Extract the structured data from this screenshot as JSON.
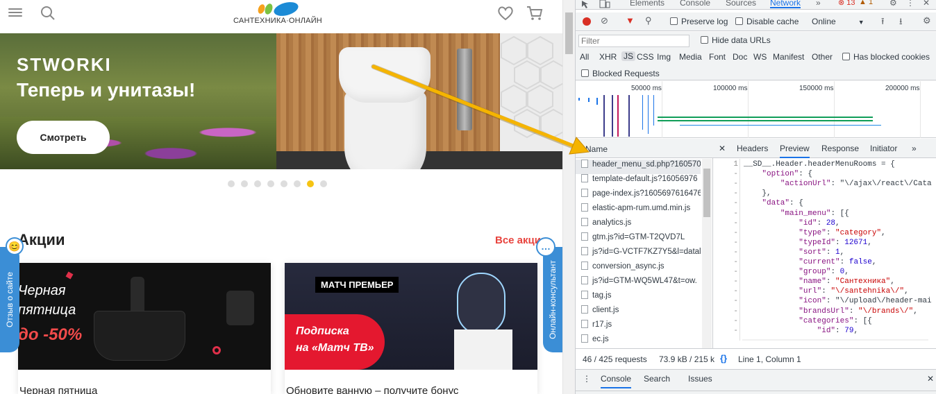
{
  "site": {
    "logo_text": "САНТЕХНИКА·ОНЛАЙН",
    "hero": {
      "brand": "STWORKI",
      "headline": "Теперь и унитазы!",
      "button": "Смотреть",
      "active_slide": 7,
      "slide_count": 8
    },
    "promotions": {
      "title": "Акции",
      "all_link": "Все акции",
      "cards": [
        {
          "caption_l1": "Черная",
          "caption_l2": "пятница",
          "discount": "до -50%",
          "title": "Черная пятница"
        },
        {
          "logo": "МАТЧ ПРЕМЬЕР",
          "badge_l1": "Подписка",
          "badge_l2": "на «Матч ТВ»",
          "title": "Обновите ванную – получите бонус"
        }
      ]
    },
    "feedback_tab": "Отзыв о сайте",
    "consultant_tab": "Онлайн-консультант"
  },
  "devtools": {
    "tabs": [
      "Elements",
      "Console",
      "Sources",
      "Network"
    ],
    "active_tab": "Network",
    "errors": "13",
    "warnings": "1",
    "toolbar": {
      "preserve_log": "Preserve log",
      "disable_cache": "Disable cache",
      "throttle": "Online"
    },
    "filter": {
      "placeholder": "Filter",
      "hide_data_urls": "Hide data URLs"
    },
    "types": [
      "All",
      "XHR",
      "JS",
      "CSS",
      "Img",
      "Media",
      "Font",
      "Doc",
      "WS",
      "Manifest",
      "Other"
    ],
    "active_type": "JS",
    "has_blocked_cookies": "Has blocked cookies",
    "blocked_requests": "Blocked Requests",
    "timeline_ticks": [
      "50000 ms",
      "100000 ms",
      "150000 ms",
      "200000 ms"
    ],
    "list_header": "Name",
    "requests": [
      "header_menu_sd.php?160570",
      "template-default.js?16056976",
      "page-index.js?1605697616476",
      "elastic-apm-rum.umd.min.js",
      "analytics.js",
      "gtm.js?id=GTM-T2QVD7L",
      "js?id=G-VCTF7KZ7Y5&l=datal",
      "conversion_async.js",
      "js?id=GTM-WQ5WL47&t=ow.",
      "tag.js",
      "client.js",
      "r17.js",
      "ec.js"
    ],
    "preview_tabs": [
      "Headers",
      "Preview",
      "Response",
      "Initiator"
    ],
    "active_preview_tab": "Preview",
    "code_lines": [
      [
        "1",
        "__SD__.Header.headerMenuRooms = {"
      ],
      [
        "-",
        "    \"option\": {"
      ],
      [
        "-",
        "        \"actionUrl\": \"\\/ajax\\/react\\/Cata"
      ],
      [
        "-",
        "    },"
      ],
      [
        "-",
        "    \"data\": {"
      ],
      [
        "-",
        "        \"main_menu\": [{"
      ],
      [
        "-",
        "            \"id\": 28,"
      ],
      [
        "-",
        "            \"type\": \"category\","
      ],
      [
        "-",
        "            \"typeId\": 12671,"
      ],
      [
        "-",
        "            \"sort\": 1,"
      ],
      [
        "-",
        "            \"current\": false,"
      ],
      [
        "-",
        "            \"group\": 0,"
      ],
      [
        "-",
        "            \"name\": \"Сантехника\","
      ],
      [
        "-",
        "            \"url\": \"\\/santehnika\\/\","
      ],
      [
        "-",
        "            \"icon\": \"\\/upload\\/header-mai"
      ],
      [
        "-",
        "            \"brandsUrl\": \"\\/brands\\/\","
      ],
      [
        "-",
        "            \"categories\": [{"
      ],
      [
        "-",
        "                \"id\": 79,"
      ]
    ],
    "status": {
      "requests": "46 / 425 requests",
      "size": "73.9 kB / 215 k",
      "position": "Line 1, Column 1"
    },
    "drawer_tabs": [
      "Console",
      "Search",
      "Issues"
    ],
    "active_drawer_tab": "Console"
  },
  "colors": {
    "accent_red": "#e8433d",
    "devtools_blue": "#1a73e8",
    "arrow": "#f5b400",
    "side_tab_blue": "#3b8ed6"
  }
}
